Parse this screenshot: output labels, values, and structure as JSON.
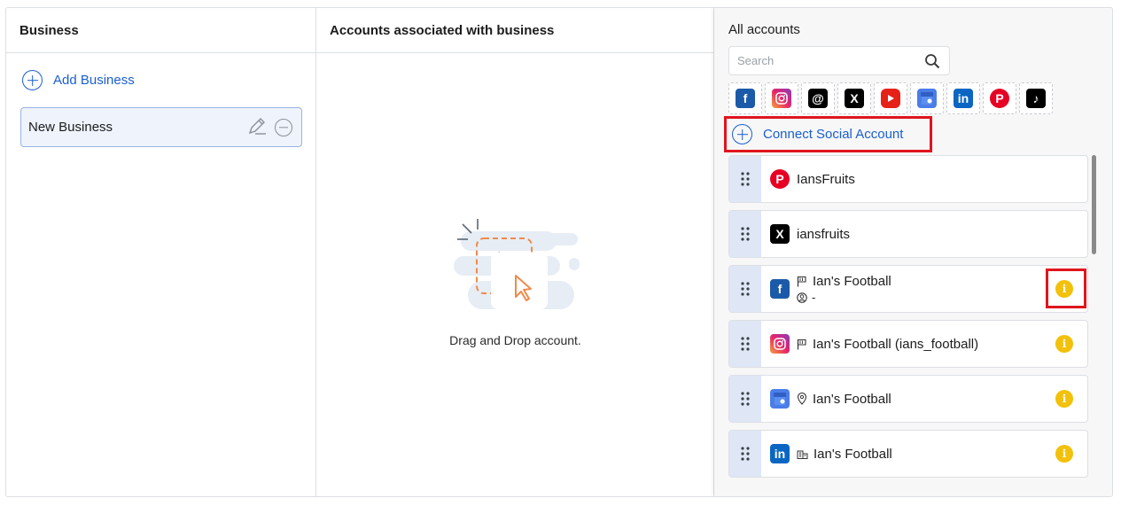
{
  "columns": {
    "business": "Business",
    "associated": "Accounts associated with business",
    "all": "All accounts"
  },
  "business": {
    "add_label": "Add Business",
    "items": [
      {
        "name": "New Business"
      }
    ]
  },
  "associated": {
    "empty_text": "Drag and Drop account."
  },
  "all_accounts": {
    "search_placeholder": "Search",
    "platforms": [
      "facebook-icon",
      "instagram-icon",
      "threads-icon",
      "x-icon",
      "youtube-icon",
      "google-business-icon",
      "linkedin-icon",
      "pinterest-icon",
      "tiktok-icon"
    ],
    "connect_label": "Connect Social Account",
    "accounts": [
      {
        "platform": "pinterest-icon",
        "name": "IansFruits",
        "type_icon": "",
        "sub": "",
        "warning": false
      },
      {
        "platform": "x-icon",
        "name": "iansfruits",
        "type_icon": "",
        "sub": "",
        "warning": false
      },
      {
        "platform": "facebook-icon",
        "name": "Ian's Football",
        "type_icon": "flag-icon",
        "sub": "-",
        "warning": true
      },
      {
        "platform": "instagram-icon",
        "name": "Ian's Football (ians_football)",
        "type_icon": "flag-icon",
        "sub": "",
        "warning": true
      },
      {
        "platform": "google-business-icon",
        "name": "Ian's Football",
        "type_icon": "location-pin-icon",
        "sub": "",
        "warning": true
      },
      {
        "platform": "linkedin-icon",
        "name": "Ian's Football",
        "type_icon": "building-icon",
        "sub": "",
        "warning": true
      }
    ]
  },
  "colors": {
    "accent": "#1a5fd0",
    "highlight": "#e0151d",
    "warning": "#f3c10b"
  }
}
